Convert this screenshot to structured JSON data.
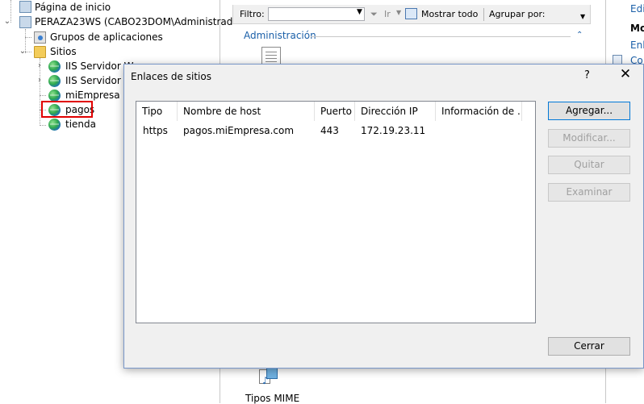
{
  "tree": {
    "start_page": "Página de inicio",
    "server": "PERAZA23WS (CABO23DOM\\Administrado",
    "app_pools": "Grupos de aplicaciones",
    "sites": "Sitios",
    "site_items": [
      "IIS Servidor W",
      "IIS Servidor W",
      "miEmpresa",
      "pagos",
      "tienda"
    ],
    "selected_site": "pagos"
  },
  "toolbar": {
    "filter_label": "Filtro:",
    "filter_value": "",
    "go_label": "Ir",
    "show_all": "Mostrar todo",
    "group_by": "Agrupar por:"
  },
  "features": {
    "section": "Administración",
    "items": [
      "Tipos MIME"
    ]
  },
  "actions": {
    "edit": "Edi",
    "manage": "Mo",
    "bindings": "Enl",
    "config": "Co"
  },
  "dialog": {
    "title": "Enlaces de sitios",
    "help": "?",
    "close": "✕",
    "columns": [
      "Tipo",
      "Nombre de host",
      "Puerto",
      "Dirección IP",
      "Información de ..."
    ],
    "rows": [
      {
        "tipo": "https",
        "host": "pagos.miEmpresa.com",
        "puerto": "443",
        "ip": "172.19.23.11",
        "info": ""
      }
    ],
    "buttons": {
      "add": "Agregar...",
      "edit": "Modificar...",
      "remove": "Quitar",
      "browse": "Examinar",
      "close": "Cerrar"
    }
  },
  "colors": {
    "link": "#1a5fa8",
    "highlight_border": "#e00000",
    "dialog_bg": "#f0f0f0",
    "primary_button_border": "#0078d7"
  }
}
